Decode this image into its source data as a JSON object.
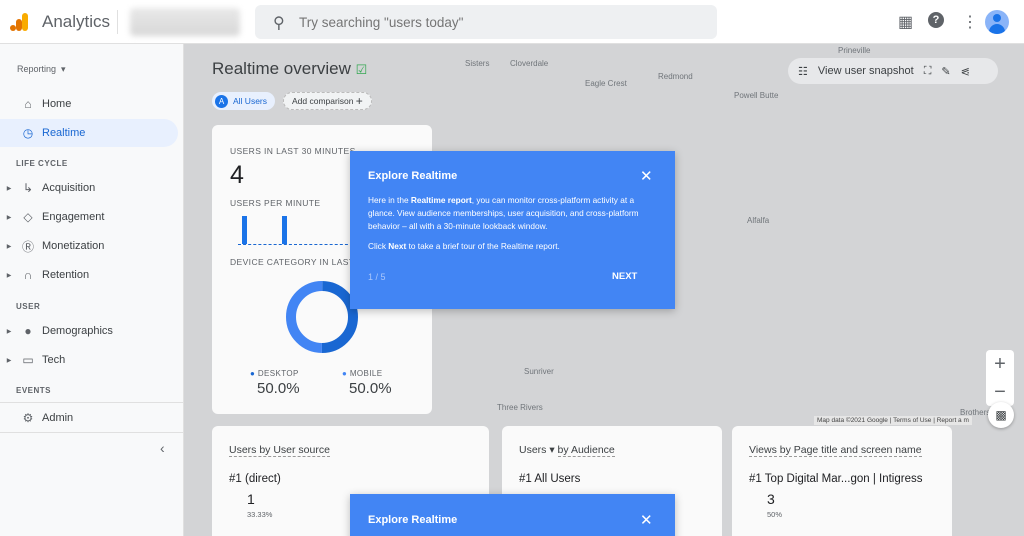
{
  "app": {
    "name": "Analytics",
    "search_placeholder": "Try searching \"users today\""
  },
  "topbar_icons": [
    "apps-icon",
    "help-icon",
    "more-vert-icon",
    "account-avatar"
  ],
  "sidebar": {
    "section_label": "Reporting",
    "items": [
      {
        "label": "Home",
        "icon": "home-icon"
      },
      {
        "label": "Realtime",
        "icon": "clock-icon",
        "active": true
      }
    ],
    "groups": [
      {
        "label": "LIFE CYCLE",
        "items": [
          {
            "label": "Acquisition",
            "icon": "acquisition-icon"
          },
          {
            "label": "Engagement",
            "icon": "tag-icon"
          },
          {
            "label": "Monetization",
            "icon": "dollar-icon"
          },
          {
            "label": "Retention",
            "icon": "magnet-icon"
          }
        ]
      },
      {
        "label": "USER",
        "items": [
          {
            "label": "Demographics",
            "icon": "globe-icon"
          },
          {
            "label": "Tech",
            "icon": "devices-icon"
          }
        ]
      },
      {
        "label": "EVENTS",
        "items": []
      }
    ],
    "admin": "Admin"
  },
  "page": {
    "title": "Realtime overview",
    "segment": "All Users",
    "segment_letter": "A",
    "add_comparison": "Add comparison",
    "snapshot": "View user snapshot"
  },
  "map": {
    "labels": [
      "Sisters",
      "Cloverdale",
      "Eagle Crest",
      "Redmond",
      "Powell Butte",
      "Prineville",
      "Alfalfa",
      "Sunriver",
      "Three Rivers",
      "Brothers"
    ],
    "attribution": "Map data ©2021 Google",
    "terms": "Terms of Use",
    "report": "Report a m"
  },
  "summary": {
    "users_label": "USERS IN LAST 30 MINUTES",
    "users": "4",
    "per_minute_label": "USERS PER MINUTE",
    "device_label": "DEVICE CATEGORY IN LAST",
    "desktop_label": "DESKTOP",
    "desktop": "50.0%",
    "mobile_label": "MOBILE",
    "mobile": "50.0%",
    "desktop_share": 50,
    "mobile_share": 50,
    "colors": {
      "desktop": "#1967d2",
      "mobile": "#4285f4"
    }
  },
  "cards": [
    {
      "title": "Users by User source",
      "rank": "#1",
      "name": "(direct)",
      "value": "1",
      "pct": "33.33%"
    },
    {
      "title_a": "Users",
      "title_b": "by Audience",
      "rank": "#1",
      "name": "All Users"
    },
    {
      "title": "Views by Page title and screen name",
      "rank": "#1",
      "name": "Top Digital Mar...gon | Intigress",
      "value": "3",
      "pct": "50%"
    }
  ],
  "tour": {
    "title": "Explore Realtime",
    "p1_a": "Here in the ",
    "p1_b": "Realtime report",
    "p1_c": ", you can monitor cross-platform activity at a glance. View audience memberships, user acquisition, and cross-platform behavior – all with a 30-minute lookback window.",
    "p2_a": "Click ",
    "p2_b": "Next",
    "p2_c": " to take a brief tour of the Realtime report.",
    "step": "1 / 5",
    "next": "NEXT",
    "color": "#4285f4"
  }
}
